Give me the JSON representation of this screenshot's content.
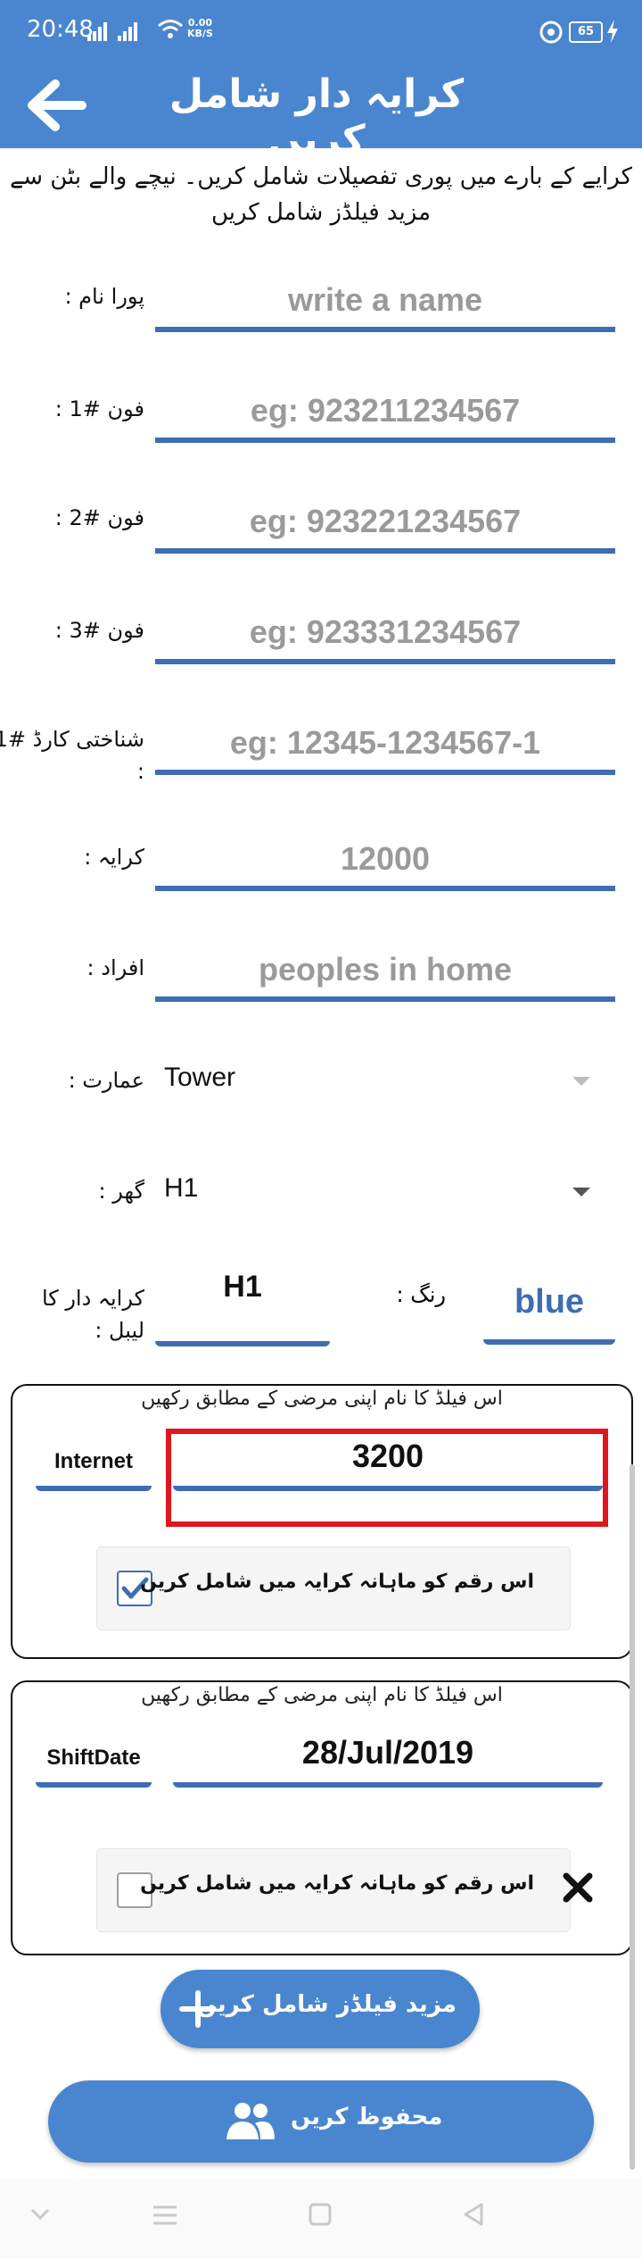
{
  "status_bar": {
    "time": "20:48",
    "speed": "0.00",
    "speed_unit": "KB/S",
    "battery": "65"
  },
  "app_bar": {
    "title": "کرایہ دار شامل کریں",
    "back_icon": "arrow-left-icon"
  },
  "intro": "کرایے کے بارے میں پوری تفصیلات شامل کریں۔ نیچے والے بٹن سے مزید فیلڈز شامل کریں",
  "form": {
    "full_name": {
      "label": "پورا نام :",
      "placeholder": "write a name"
    },
    "phone1": {
      "label": "فون #1 :",
      "placeholder": "eg: 923211234567"
    },
    "phone2": {
      "label": "فون #2 :",
      "placeholder": "eg: 923221234567"
    },
    "phone3": {
      "label": "فون #3 :",
      "placeholder": "eg: 923331234567"
    },
    "cnic": {
      "label": "شناختی کارڈ #1 :",
      "placeholder": "eg: 12345-1234567-1"
    },
    "rent": {
      "label": "کرایہ :",
      "placeholder": "12000"
    },
    "persons": {
      "label": "افراد :",
      "placeholder": "peoples in home"
    },
    "building": {
      "label": "عمارت :",
      "value": "Tower"
    },
    "house": {
      "label": "گھر :",
      "value": "H1"
    },
    "tenant_label": {
      "label": "کرایہ دار کا لیبل :",
      "value": "H1"
    },
    "color": {
      "label": "رنگ :",
      "value": "blue",
      "color": "#3f6db3"
    }
  },
  "custom_fields": [
    {
      "hint": "اس فیلڈ کا نام اپنی مرضی کے مطابق رکھیں",
      "name": "Internet",
      "value": "3200",
      "checkbox_label": "اس رقم کو ماہانہ کرایہ میں شامل کریں",
      "checked": true
    },
    {
      "hint": "اس فیلڈ کا نام اپنی مرضی کے مطابق رکھیں",
      "name": "ShiftDate",
      "value": "28/Jul/2019",
      "checkbox_label": "اس رقم کو ماہانہ کرایہ میں شامل کریں",
      "checked": false
    }
  ],
  "add_fields_button": "مزید فیلڈز شامل کریں",
  "save_button": "محفوظ کریں",
  "colors": {
    "primary": "#4a86cf",
    "accent_line": "#3f6db3",
    "highlight": "#e0161e"
  }
}
